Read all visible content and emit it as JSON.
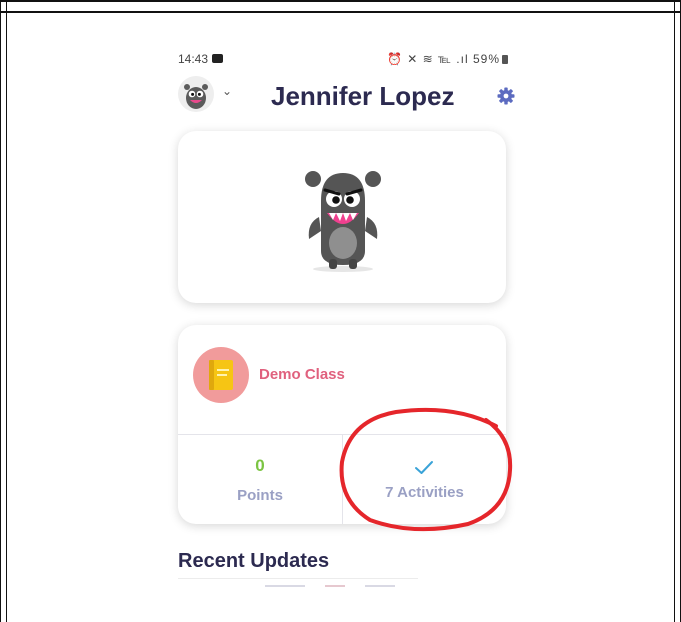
{
  "status_bar": {
    "time": "14:43",
    "icons_right": "⏰ ✕ ≋ ℡ .ıl",
    "battery": "59%"
  },
  "header": {
    "user_name": "Jennifer Lopez",
    "avatar_icon": "monster-avatar-icon",
    "menu_icon": "chevron-down-icon",
    "settings_icon": "gear-icon"
  },
  "class_card": {
    "class_name": "Demo Class",
    "class_icon": "notebook-icon",
    "points_value": "0",
    "points_label": "Points",
    "activities_icon": "check-icon",
    "activities_label": "7 Activities"
  },
  "recent": {
    "title": "Recent Updates"
  },
  "colors": {
    "title": "#2c2a50",
    "accent_pink": "#e0617e",
    "points_green": "#7bc442",
    "label_muted": "#9aa0c4",
    "annotation_red": "#e5262b"
  }
}
